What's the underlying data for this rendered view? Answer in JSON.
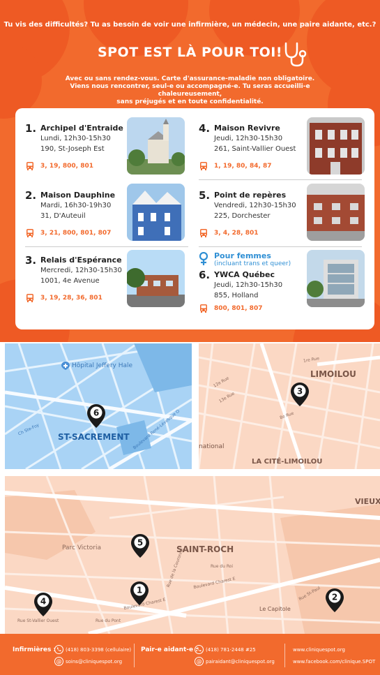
{
  "header": {
    "question": "Tu vis des difficultés? Tu as besoin de voir une infirmière, un médecin, une paire aidante, etc.?",
    "slogan": "SPOT EST LÀ POUR TOI!",
    "sub_line_1": "Avec ou sans rendez-vous. Carte d'assurance-maladie non obligatoire.",
    "sub_line_2": "Viens nous rencontrer, seul-e ou accompagné-e. Tu seras accueilli-e chaleureusement,",
    "sub_line_3": "sans préjugés et en toute confidentialité."
  },
  "locations": [
    {
      "num": "1.",
      "name": "Archipel d'Entraide",
      "schedule": "Lundi, 12h30-15h30",
      "address": "190, St-Joseph Est",
      "routes": "3, 19, 800, 801"
    },
    {
      "num": "2.",
      "name": "Maison Dauphine",
      "schedule": "Mardi, 16h30-19h30",
      "address": "31, D'Auteuil",
      "routes": "3, 21, 800, 801, 807"
    },
    {
      "num": "3.",
      "name": "Relais d'Espérance",
      "schedule": "Mercredi, 12h30-15h30",
      "address": "1001, 4e Avenue",
      "routes": "3, 19, 28, 36, 801"
    },
    {
      "num": "4.",
      "name": "Maison Revivre",
      "schedule": "Jeudi, 12h30-15h30",
      "address": "261, Saint-Vallier Ouest",
      "routes": "1, 19, 80, 84, 87"
    },
    {
      "num": "5.",
      "name": "Point de repères",
      "schedule": "Vendredi, 12h30-15h30",
      "address": "225, Dorchester",
      "routes": "3, 4, 28, 801"
    },
    {
      "num": "6.",
      "name": "YWCA Québec",
      "schedule": "Jeudi, 12h30-15h30",
      "address": "855, Holland",
      "routes": "800, 801, 807"
    }
  ],
  "women": {
    "label": "Pour femmes",
    "sub": "(incluant trans et queer)"
  },
  "maps": {
    "hospital": "Hôpital Jeffery Hale",
    "st_sacrement": "ST-SACREMENT",
    "limoilou": "LIMOILOU",
    "cite_limoilou": "LA CITÉ-LIMOILOU",
    "national": "national",
    "saint_roch": "SAINT-ROCH",
    "parc_victoria": "Parc Victoria",
    "vieux": "VIEUX",
    "le_capitole": "Le Capitole",
    "streets": {
      "chemin_sainte_foy": "Ch Ste-Foy",
      "rue_saint_vallier_ouest": "Rue St-Vallier Ouest",
      "boulevard_charest_est": "Boulevard Charest E",
      "rue_du_pont": "Rue du Pont",
      "premiere_rue": "1re Rue",
      "huitieme_rue": "8e Rue",
      "douzieme_rue": "12e Rue",
      "treizieme_rue": "13e Rue",
      "boulevard_rene_levesque": "Boulevard René-Lévesque O",
      "rue_saint_paul": "Rue St-Paul",
      "rue_de_la_couronne": "Rue de la Couronne",
      "rue_du_roi": "Rue du Roi"
    },
    "pins": [
      "1",
      "2",
      "3",
      "4",
      "5",
      "6"
    ]
  },
  "footer": {
    "nurses_label": "Infirmières :",
    "nurses_phone": "(418) 803-3398 (cellulaire)",
    "nurses_email": "soins@cliniquespot.org",
    "peer_label": "Pair-e aidant-e :",
    "peer_phone": "(418) 781-2448 #25",
    "peer_email": "pairaidant@cliniquespot.org",
    "website": "www.cliniquespot.org",
    "facebook": "www.facebook.com/clinique.SPOT"
  },
  "colors": {
    "brand_orange": "#f26a2d",
    "women_blue": "#2f8fd4",
    "map_blue": "#a9d3f5",
    "map_peach": "#fbd8c4"
  },
  "icons": [
    "stethoscope-icon",
    "bus-icon",
    "female-symbol-icon",
    "hospital-icon",
    "phone-icon",
    "email-icon",
    "map-pin-icon"
  ]
}
